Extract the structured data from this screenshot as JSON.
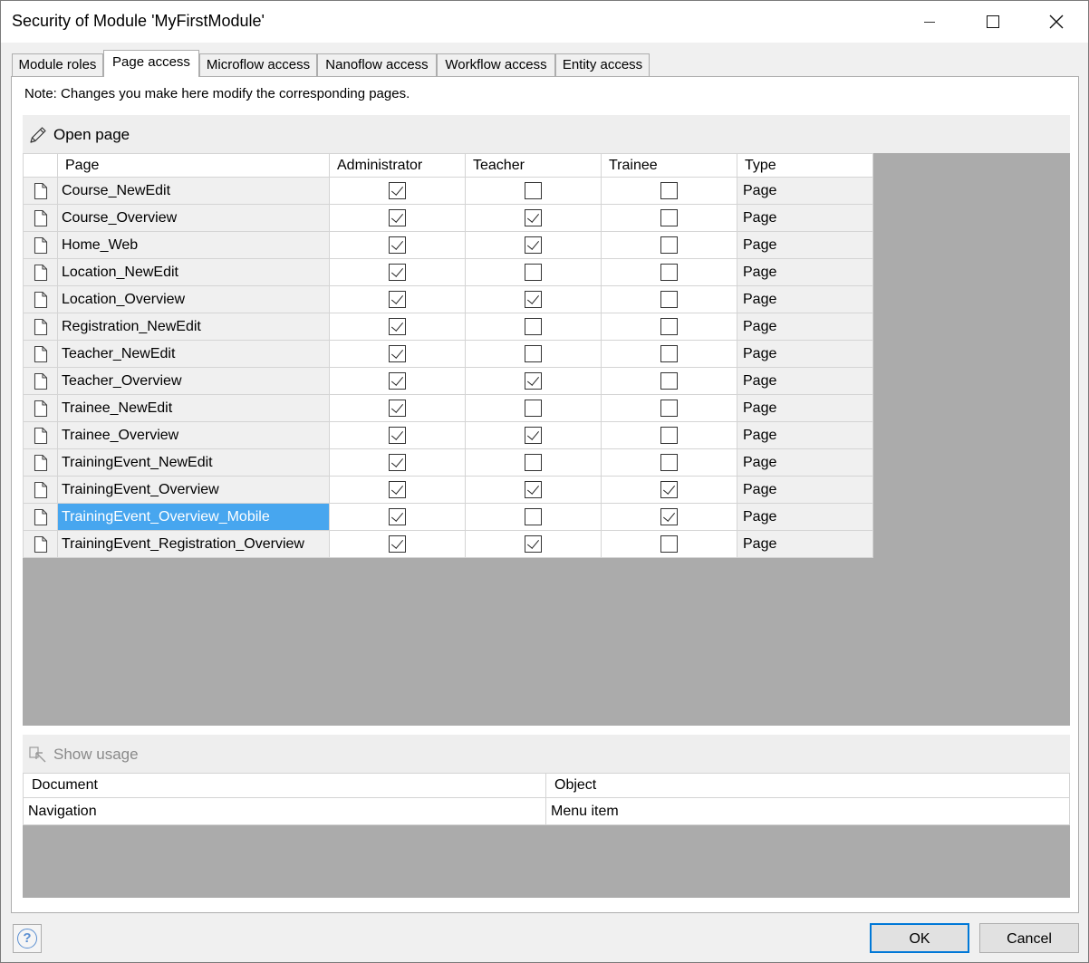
{
  "window": {
    "title": "Security of Module 'MyFirstModule'"
  },
  "tabs": [
    {
      "label": "Module roles"
    },
    {
      "label": "Page access"
    },
    {
      "label": "Microflow access"
    },
    {
      "label": "Nanoflow access"
    },
    {
      "label": "Workflow access"
    },
    {
      "label": "Entity access"
    }
  ],
  "active_tab": "Page access",
  "note": "Note: Changes you make here modify the corresponding pages.",
  "toolbar": {
    "open_page_label": "Open page"
  },
  "grid": {
    "columns": [
      "Page",
      "Administrator",
      "Teacher",
      "Trainee",
      "Type"
    ],
    "rows": [
      {
        "page": "Course_NewEdit",
        "administrator": true,
        "teacher": false,
        "trainee": false,
        "type": "Page"
      },
      {
        "page": "Course_Overview",
        "administrator": true,
        "teacher": true,
        "trainee": false,
        "type": "Page"
      },
      {
        "page": "Home_Web",
        "administrator": true,
        "teacher": true,
        "trainee": false,
        "type": "Page"
      },
      {
        "page": "Location_NewEdit",
        "administrator": true,
        "teacher": false,
        "trainee": false,
        "type": "Page"
      },
      {
        "page": "Location_Overview",
        "administrator": true,
        "teacher": true,
        "trainee": false,
        "type": "Page"
      },
      {
        "page": "Registration_NewEdit",
        "administrator": true,
        "teacher": false,
        "trainee": false,
        "type": "Page"
      },
      {
        "page": "Teacher_NewEdit",
        "administrator": true,
        "teacher": false,
        "trainee": false,
        "type": "Page"
      },
      {
        "page": "Teacher_Overview",
        "administrator": true,
        "teacher": true,
        "trainee": false,
        "type": "Page"
      },
      {
        "page": "Trainee_NewEdit",
        "administrator": true,
        "teacher": false,
        "trainee": false,
        "type": "Page"
      },
      {
        "page": "Trainee_Overview",
        "administrator": true,
        "teacher": true,
        "trainee": false,
        "type": "Page"
      },
      {
        "page": "TrainingEvent_NewEdit",
        "administrator": true,
        "teacher": false,
        "trainee": false,
        "type": "Page"
      },
      {
        "page": "TrainingEvent_Overview",
        "administrator": true,
        "teacher": true,
        "trainee": true,
        "type": "Page"
      },
      {
        "page": "TrainingEvent_Overview_Mobile",
        "administrator": true,
        "teacher": false,
        "trainee": true,
        "type": "Page",
        "selected": true
      },
      {
        "page": "TrainingEvent_Registration_Overview",
        "administrator": true,
        "teacher": true,
        "trainee": false,
        "type": "Page"
      }
    ]
  },
  "usage": {
    "show_usage_label": "Show usage",
    "columns": [
      "Document",
      "Object"
    ],
    "rows": [
      {
        "document": "Navigation",
        "object": "Menu item"
      }
    ]
  },
  "footer": {
    "ok_label": "OK",
    "cancel_label": "Cancel",
    "help_glyph": "?"
  },
  "colors": {
    "selection": "#47a6ef",
    "grid_background": "#ababab",
    "ok_border": "#0078d7"
  }
}
